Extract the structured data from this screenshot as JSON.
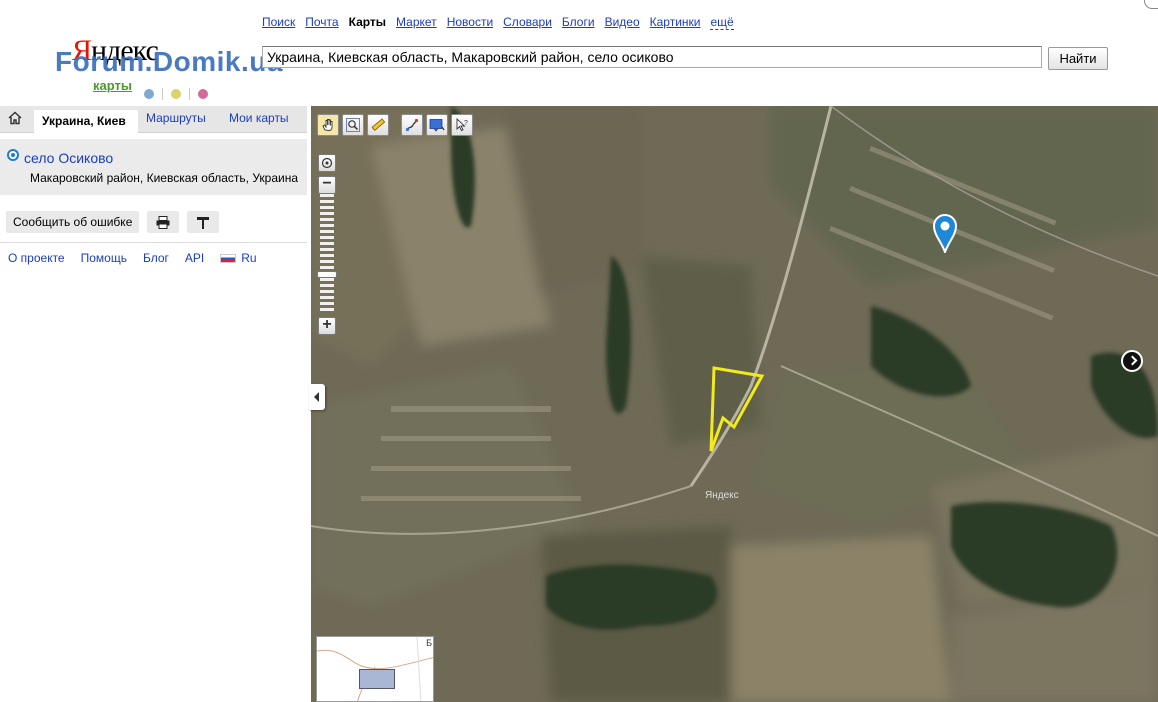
{
  "topnav": {
    "items": [
      {
        "label": "Поиск"
      },
      {
        "label": "Почта"
      },
      {
        "label": "Карты",
        "current": true
      },
      {
        "label": "Маркет"
      },
      {
        "label": "Новости"
      },
      {
        "label": "Словари"
      },
      {
        "label": "Блоги"
      },
      {
        "label": "Видео"
      },
      {
        "label": "Картинки"
      },
      {
        "label": "ещё"
      }
    ]
  },
  "logo": {
    "text_first": "Я",
    "text_rest": "ндекс",
    "service": "карты",
    "dot_colors": [
      "#7fa9cf",
      "#d8d36a",
      "#d46a9a"
    ]
  },
  "watermark": "Forum.Domik.ua",
  "search": {
    "value": "Украина, Киевская область, Макаровский район, село осиково",
    "button_label": "Найти"
  },
  "panel": {
    "tabs": [
      {
        "label": "Украина, Киев"
      },
      {
        "label": "Маршруты"
      },
      {
        "label": "Мои карты"
      }
    ],
    "result": {
      "name": "село Осиково",
      "address": "Макаровский район, Киевская область, Украина"
    },
    "report_button": "Сообщить об ошибке",
    "footer_links": [
      {
        "label": "О проекте"
      },
      {
        "label": "Помощь"
      },
      {
        "label": "Блог"
      },
      {
        "label": "API"
      }
    ],
    "language": "Ru"
  },
  "map": {
    "label": "Яндекс",
    "minimap_label": "Б",
    "highlight_color": "#f2ea1a",
    "pin_color": "#1e88d8"
  }
}
